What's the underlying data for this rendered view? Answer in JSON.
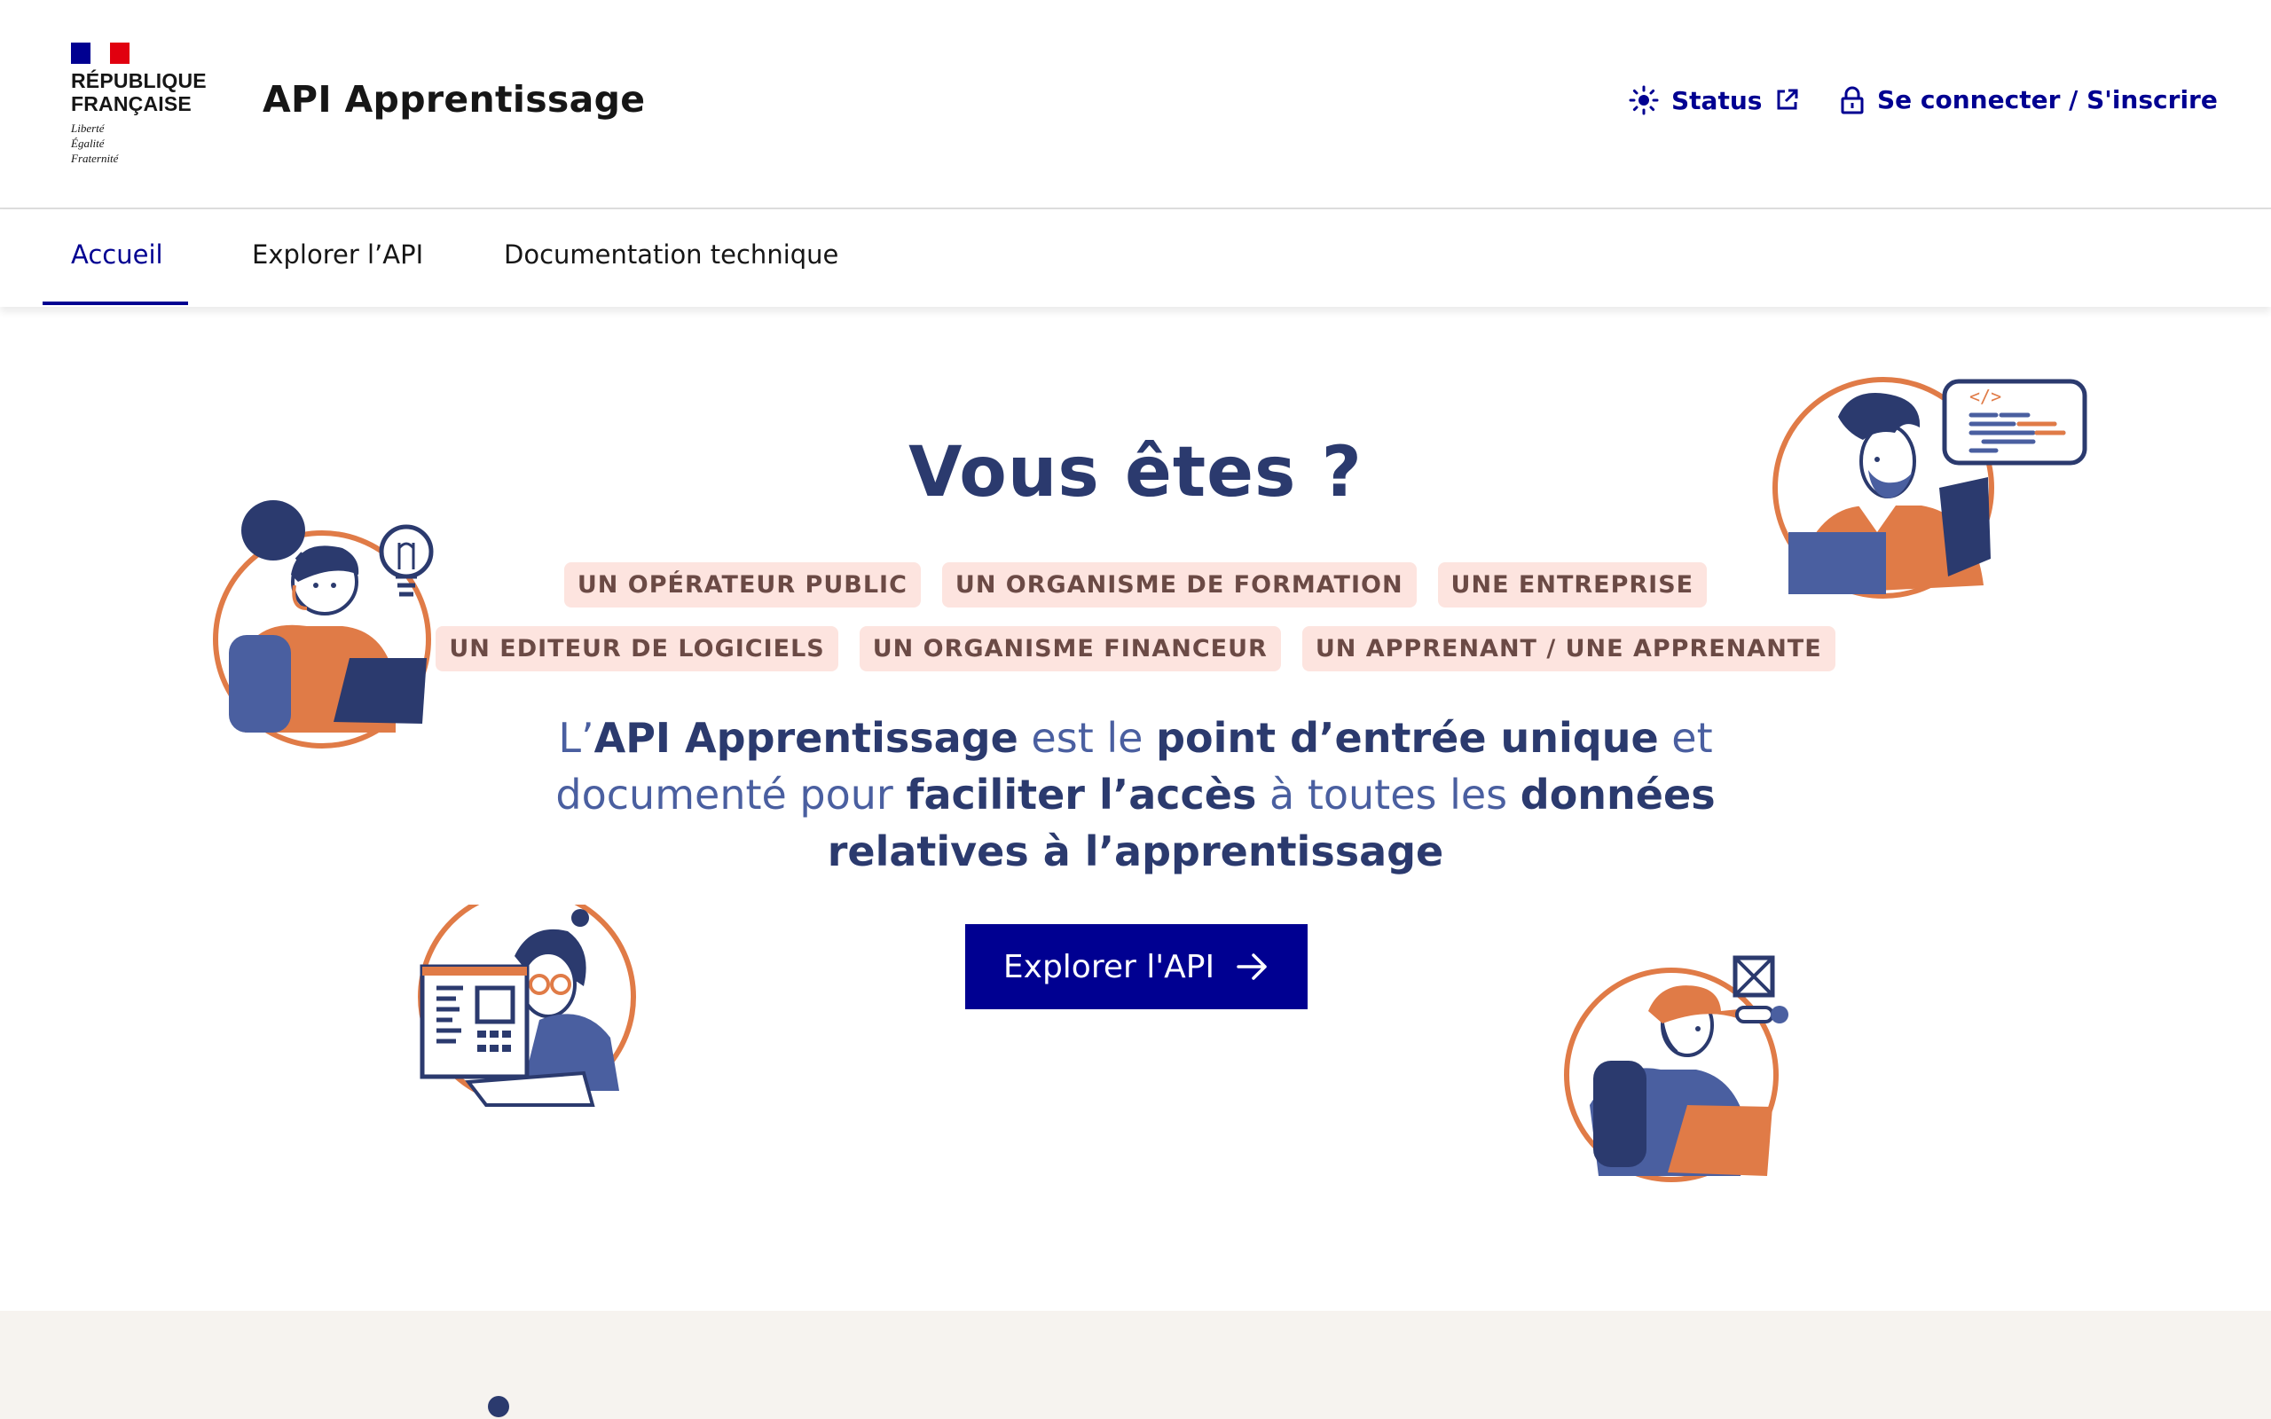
{
  "header": {
    "logo": {
      "line1": "RÉPUBLIQUE",
      "line2": "FRANÇAISE",
      "motto1": "Liberté",
      "motto2": "Égalité",
      "motto3": "Fraternité",
      "flag_colors": [
        "#000091",
        "#ffffff",
        "#e1000f"
      ]
    },
    "site_title": "API Apprentissage",
    "tools": {
      "status_label": "Status",
      "login_label": "Se connecter / S'inscrire"
    }
  },
  "nav": {
    "items": [
      {
        "label": "Accueil",
        "active": true
      },
      {
        "label": "Explorer l’API",
        "active": false
      },
      {
        "label": "Documentation technique",
        "active": false
      }
    ]
  },
  "hero": {
    "title": "Vous êtes ?",
    "tags_row1": [
      "UN OPÉRATEUR PUBLIC",
      "UN ORGANISME DE FORMATION",
      "UNE ENTREPRISE"
    ],
    "tags_row2": [
      "UN EDITEUR DE LOGICIELS",
      "UN ORGANISME FINANCEUR",
      "UN APPRENANT / UNE APPRENANTE"
    ],
    "intro": {
      "p1": "L’",
      "b1": "API Apprentissage",
      "p2": " est le ",
      "b2": "point d’entrée unique",
      "p3": " et documenté pour ",
      "b3": "faciliter l’accès",
      "p4": " à toutes les ",
      "b4": "données relatives à l’apprentissage"
    },
    "cta_label": "Explorer l'API"
  },
  "colors": {
    "primary": "#000091",
    "navy": "#2b3a6e",
    "blue": "#4a5fa0",
    "orange": "#e07b47",
    "tag_bg": "#fde4df"
  }
}
